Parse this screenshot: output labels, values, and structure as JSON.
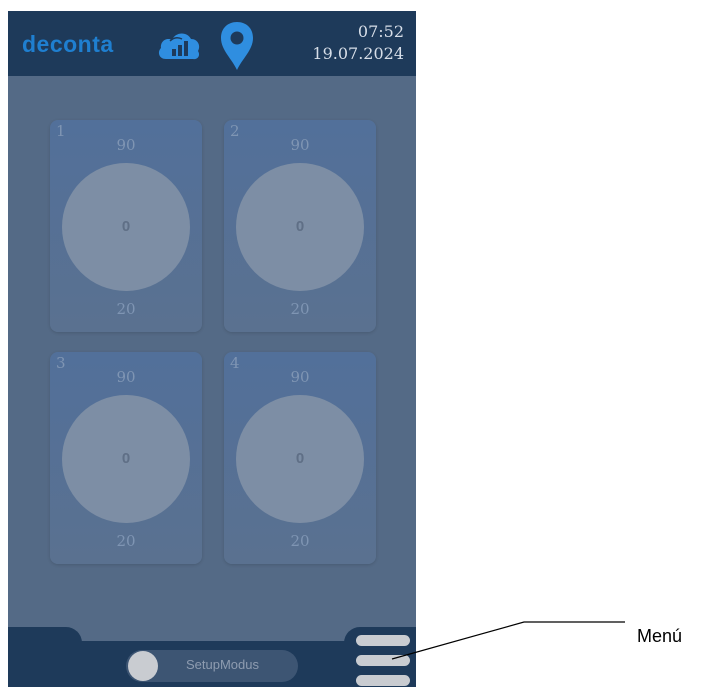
{
  "header": {
    "brand": "deconta",
    "cloud_icon": "cloud-signal-icon",
    "location_icon": "location-pin-icon",
    "time": "07:52",
    "date": "19.07.2024",
    "colors": {
      "bar": "#1e3a5a",
      "brand": "#1f7fd0"
    }
  },
  "tiles": [
    {
      "number": "1",
      "max": "90",
      "value": "0",
      "min": "20"
    },
    {
      "number": "2",
      "max": "90",
      "value": "0",
      "min": "20"
    },
    {
      "number": "3",
      "max": "90",
      "value": "0",
      "min": "20"
    },
    {
      "number": "4",
      "max": "90",
      "value": "0",
      "min": "20"
    }
  ],
  "footer": {
    "toggle_label": "SetupModus",
    "menu_icon": "hamburger-menu-icon"
  },
  "annotation": {
    "label": "Menú"
  }
}
